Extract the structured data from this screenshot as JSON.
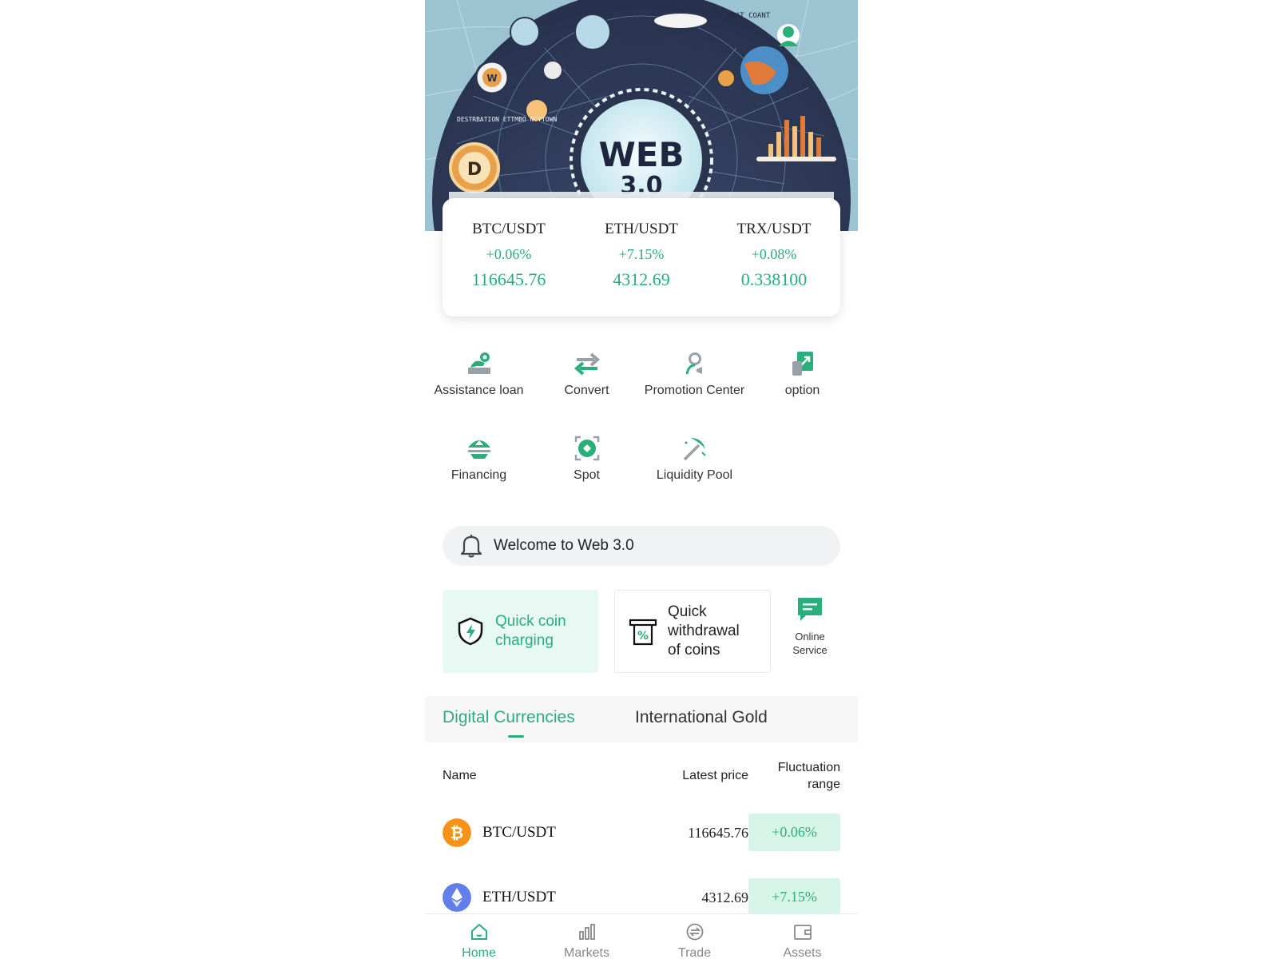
{
  "banner": {
    "title_line1": "WEB",
    "title_line2": "3.0",
    "caption": "SMAT COANT",
    "side_text": "DESTRBATION ETTMBO NCTTOWN",
    "coin_letter": "D",
    "coin_letter_small": "W"
  },
  "tickers": [
    {
      "pair": "BTC/USDT",
      "change": "+0.06%",
      "price": "116645.76"
    },
    {
      "pair": "ETH/USDT",
      "change": "+7.15%",
      "price": "4312.69"
    },
    {
      "pair": "TRX/USDT",
      "change": "+0.08%",
      "price": "0.338100"
    }
  ],
  "features": [
    {
      "label": "Assistance loan",
      "icon": "loan-icon"
    },
    {
      "label": "Convert",
      "icon": "convert-arrows-icon"
    },
    {
      "label": "Promotion Center",
      "icon": "promotion-person-icon"
    },
    {
      "label": "option",
      "icon": "option-chart-icon"
    },
    {
      "label": "Financing",
      "icon": "financing-icon"
    },
    {
      "label": "Spot",
      "icon": "spot-icon"
    },
    {
      "label": "Liquidity Pool",
      "icon": "pickaxe-icon"
    }
  ],
  "notice": {
    "text": "Welcome to Web 3.0",
    "icon": "bell-icon"
  },
  "quick_actions": {
    "charge": {
      "label": "Quick coin charging",
      "icon": "shield-bolt-icon"
    },
    "withdraw": {
      "label": "Quick withdrawal of coins",
      "icon": "receipt-percent-icon"
    },
    "online": {
      "label": "Online Service",
      "icon": "chat-icon"
    }
  },
  "tabs": {
    "active": "Digital Currencies",
    "inactive": "International Gold"
  },
  "table": {
    "headers": {
      "name": "Name",
      "price": "Latest price",
      "fluctuation": "Fluctuation range"
    },
    "rows": [
      {
        "pair": "BTC/USDT",
        "price": "116645.76",
        "change": "+0.06%",
        "icon": "bitcoin-icon",
        "icon_glyph": "₿",
        "icon_color": "#f7931a"
      },
      {
        "pair": "ETH/USDT",
        "price": "4312.69",
        "change": "+7.15%",
        "icon": "ethereum-icon",
        "icon_glyph": "♦",
        "icon_color": "#627eea"
      }
    ]
  },
  "bottom_nav": [
    {
      "label": "Home",
      "icon": "home-icon"
    },
    {
      "label": "Markets",
      "icon": "bar-chart-icon"
    },
    {
      "label": "Trade",
      "icon": "exchange-icon"
    },
    {
      "label": "Assets",
      "icon": "wallet-icon"
    }
  ],
  "colors": {
    "accent": "#2aae7a",
    "accent_light": "#e8f8f2",
    "change_bg": "#d6f5e8"
  }
}
